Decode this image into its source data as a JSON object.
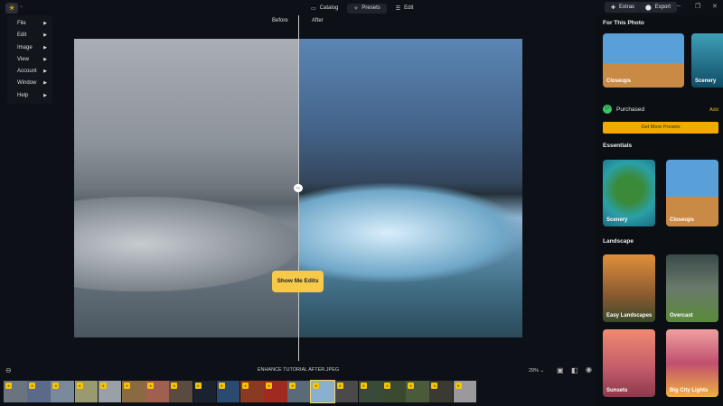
{
  "app": {
    "logo_icon": "sun-logo-icon"
  },
  "menu": [
    {
      "label": "File"
    },
    {
      "label": "Edit"
    },
    {
      "label": "Image"
    },
    {
      "label": "View"
    },
    {
      "label": "Account"
    },
    {
      "label": "Window"
    },
    {
      "label": "Help"
    }
  ],
  "topnav": {
    "catalog": "Catalog",
    "presets": "Presets",
    "edit": "Edit"
  },
  "toolbar": {
    "extras": "Extras",
    "export": "Export"
  },
  "compare": {
    "before": "Before",
    "after": "After",
    "show_edits": "Show Me Edits"
  },
  "panel": {
    "for_this_photo": "For This Photo",
    "photo_cards": [
      {
        "label": "Closeups",
        "color": "#c98a45"
      },
      {
        "label": "Scenery",
        "color": "#1d7a96"
      }
    ],
    "purchased": "Purchased",
    "add": "Add",
    "get_more": "Get More Presets",
    "essentials": "Essentials",
    "essential_cards": [
      {
        "label": "Scenery",
        "color": "#2b8a7a"
      },
      {
        "label": "Closeups",
        "color": "#c98a45"
      }
    ],
    "landscape": "Landscape",
    "landscape_cards": [
      {
        "label": "Easy Landscapes",
        "color": "#c27a35"
      },
      {
        "label": "Overcast",
        "color": "#4d6b3a"
      },
      {
        "label": "Sunsets",
        "color": "#d9706a"
      },
      {
        "label": "Big City Lights",
        "color": "#c25a6a"
      }
    ]
  },
  "bottom": {
    "filename": "ENHANCE TUTORIAL AFTER.JPEG",
    "zoom": "29%"
  },
  "filmstrip": {
    "selected_index": 13,
    "colors": [
      "#6a7480",
      "#5a6a88",
      "#7a8a9a",
      "#9a9a70",
      "#9aa0a8",
      "#8a6a40",
      "#a06050",
      "#5a4a40",
      "#1a2230",
      "#2a4a70",
      "#8a3a20",
      "#a02a20",
      "#5a6a78",
      "#8ab0d0",
      "#4a4a4a",
      "#3a4a3a",
      "#3a4a30",
      "#4a5a3a",
      "#3a3a30",
      "#9a9a9a"
    ]
  }
}
